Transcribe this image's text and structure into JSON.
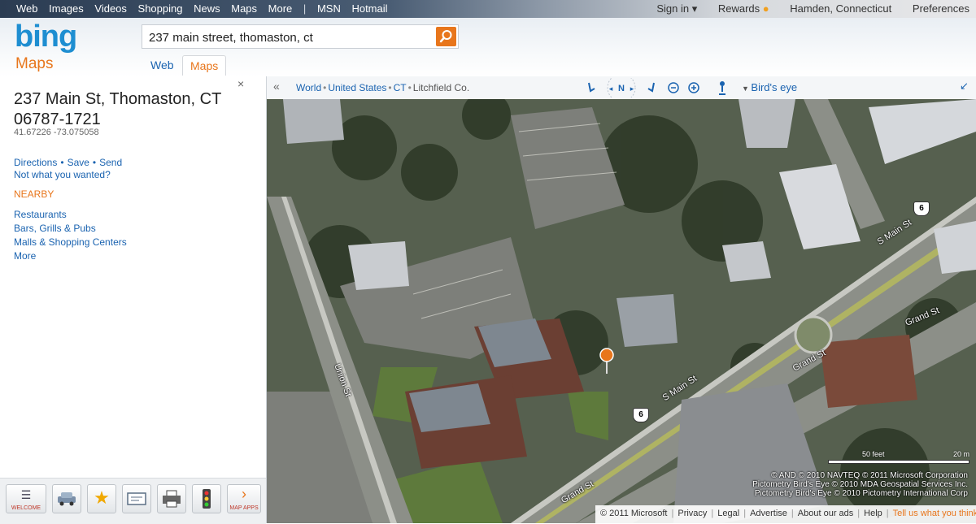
{
  "topnav": {
    "links": [
      "Web",
      "Images",
      "Videos",
      "Shopping",
      "News",
      "Maps",
      "More"
    ],
    "separator": "|",
    "extra": [
      "MSN",
      "Hotmail"
    ],
    "sign_in": "Sign in ▾",
    "rewards": "Rewards",
    "location": "Hamden, Connecticut",
    "preferences": "Preferences"
  },
  "header": {
    "logo": "bing",
    "logo_sub": "Maps",
    "search_value": "237 main street, thomaston, ct",
    "tabs": [
      "Web",
      "Maps"
    ],
    "active_tab": "Maps"
  },
  "panel": {
    "close": "×",
    "address_line1": "237 Main St, Thomaston, CT",
    "address_line2": "06787-1721",
    "coords": "41.67226 -73.075058",
    "actions": [
      "Directions",
      "Save",
      "Send"
    ],
    "not_wanted": "Not what you wanted?",
    "nearby_heading": "NEARBY",
    "nearby": [
      "Restaurants",
      "Bars, Grills & Pubs",
      "Malls & Shopping Centers",
      "More"
    ]
  },
  "toolbar": {
    "buttons": [
      {
        "name": "welcome",
        "label": "WELCOME"
      },
      {
        "name": "car",
        "label": ""
      },
      {
        "name": "favorites",
        "label": ""
      },
      {
        "name": "business-card",
        "label": ""
      },
      {
        "name": "print",
        "label": ""
      },
      {
        "name": "traffic",
        "label": ""
      },
      {
        "name": "map-apps",
        "label": "MAP APPS"
      }
    ]
  },
  "mapbar": {
    "collapse": "«",
    "breadcrumb": [
      "World",
      "United States",
      "CT",
      "Litchfield Co."
    ],
    "compass": "N",
    "view": "Bird's eye",
    "expand": "↙"
  },
  "map": {
    "streets": [
      "S Main St",
      "S Main St",
      "Grand St",
      "Grand St",
      "Grand St",
      "Union St"
    ],
    "route": "6",
    "scale_feet": "50 feet",
    "scale_m": "20 m",
    "credits": [
      "© AND  © 2010 NAVTEQ  © 2011 Microsoft Corporation",
      "Pictometry Bird's Eye © 2010 MDA Geospatial Services Inc.",
      "Pictometry Bird's Eye © 2010 Pictometry International Corp"
    ]
  },
  "footer": {
    "items": [
      "© 2011 Microsoft",
      "Privacy",
      "Legal",
      "Advertise",
      "About our ads",
      "Help"
    ],
    "tell": "Tell us what you think"
  },
  "colors": {
    "bing_blue": "#1e8ed1",
    "maps_orange": "#e8761c",
    "link_blue": "#1a63b0"
  }
}
